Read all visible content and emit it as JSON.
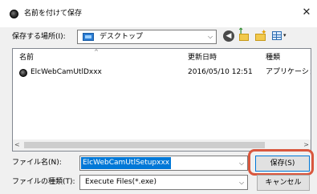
{
  "window": {
    "title": "名前を付けて保存",
    "close_glyph": "✕"
  },
  "location": {
    "label": "保存する場所(I):",
    "value": "デスクトップ",
    "arrow": "⌵"
  },
  "toolbar": {
    "back_glyph": "◀",
    "up_glyph": "↑",
    "new_glyph": "✦",
    "view_glyph": "▾"
  },
  "file_list": {
    "sort_caret": "^",
    "columns": [
      "名前",
      "更新日時",
      "種類"
    ],
    "rows": [
      {
        "name": "ElcWebCamUtlDxxx",
        "modified": "2016/05/10 12:51",
        "type": "アプリケーション"
      }
    ],
    "scroll_left": "<",
    "scroll_right": ">"
  },
  "file_name": {
    "label": "ファイル名(N):",
    "value": "ElcWebCamUtlSetupxxx",
    "arrow": "⌵"
  },
  "file_type": {
    "label": "ファイルの種類(T):",
    "value": "Execute Files(*.exe)",
    "arrow": "⌵"
  },
  "buttons": {
    "save": "保存(S)",
    "cancel": "キャンセル"
  },
  "colors": {
    "selection": "#0078d7",
    "highlight_ring": "#d9573e",
    "folder": "#2b7cd3"
  }
}
